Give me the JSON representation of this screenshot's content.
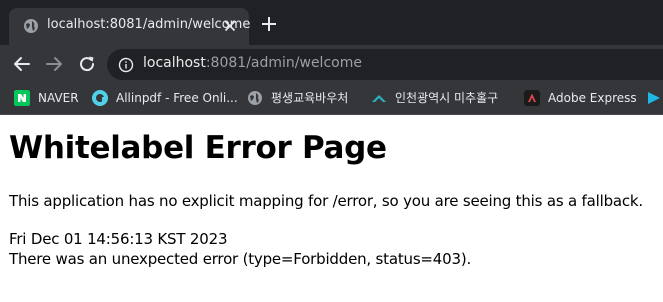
{
  "browser": {
    "tab": {
      "title": "localhost:8081/admin/welcome",
      "favicon": "globe-icon"
    },
    "new_tab_icon": "plus-icon",
    "nav": {
      "back_icon": "back-arrow-icon",
      "forward_icon": "forward-arrow-icon",
      "reload_icon": "reload-icon"
    },
    "address": {
      "host": "localhost",
      "rest": ":8081/admin/welcome",
      "security_icon": "info-icon"
    },
    "bookmarks": [
      {
        "label": "NAVER",
        "icon": "naver-icon",
        "color": "#03c75a"
      },
      {
        "label": "Allinpdf - Free Onli...",
        "icon": "allinpdf-icon",
        "color": "#4fd1e8"
      },
      {
        "label": "평생교육바우처",
        "icon": "globe-icon",
        "color": "#9aa0a6"
      },
      {
        "label": "인천광역시 미추홀구",
        "icon": "michuhol-icon",
        "color": "#2bb3c0"
      },
      {
        "label": "Adobe Express",
        "icon": "adobe-express-icon",
        "color": "#e34850"
      }
    ]
  },
  "page": {
    "title": "Whitelabel Error Page",
    "message": "This application has no explicit mapping for /error, so you are seeing this as a fallback.",
    "timestamp": "Fri Dec 01 14:56:13 KST 2023",
    "detail": "There was an unexpected error (type=Forbidden, status=403)."
  }
}
